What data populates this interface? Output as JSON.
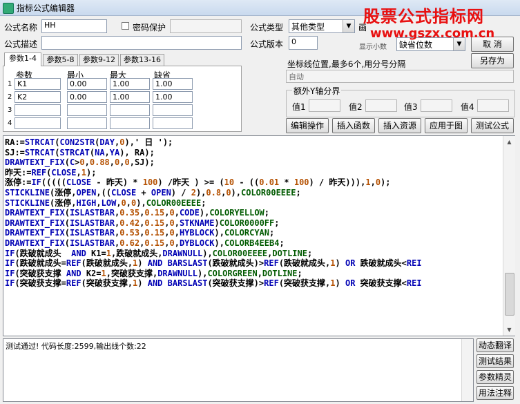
{
  "window": {
    "title": "指标公式编辑器"
  },
  "watermark": {
    "line1": "股票公式指标网",
    "line2": "www.gszx.com.cn",
    "color": "#e81010"
  },
  "form": {
    "name_label": "公式名称",
    "name_value": "HH",
    "password_label": "密码保护",
    "password_checked": false,
    "type_label": "公式类型",
    "type_value": "其他类型",
    "draw_label": "画",
    "desc_label": "公式描述",
    "desc_value": "",
    "version_label": "公式版本",
    "version_value": "0",
    "display_label": "显示小数",
    "display_value": "缺省位数"
  },
  "right_buttons": {
    "cancel": "取 消",
    "save_as": "另存为"
  },
  "tabs": [
    {
      "label": "参数1-4",
      "active": true
    },
    {
      "label": "参数5-8",
      "active": false
    },
    {
      "label": "参数9-12",
      "active": false
    },
    {
      "label": "参数13-16",
      "active": false
    }
  ],
  "params": {
    "headers": {
      "name": "参数",
      "min": "最小",
      "max": "最大",
      "default": "缺省"
    },
    "rows": [
      {
        "num": "1",
        "name": "K1",
        "min": "0.00",
        "max": "1.00",
        "default": "1.00"
      },
      {
        "num": "2",
        "name": "K2",
        "min": "0.00",
        "max": "1.00",
        "default": "1.00"
      },
      {
        "num": "3",
        "name": "",
        "min": "",
        "max": "",
        "default": ""
      },
      {
        "num": "4",
        "name": "",
        "min": "",
        "max": "",
        "default": ""
      }
    ]
  },
  "axis": {
    "label": "坐标线位置,最多6个,用分号分隔",
    "value": "自动",
    "extra_group_title": "额外Y轴分界",
    "values": [
      {
        "label": "值1",
        "value": ""
      },
      {
        "label": "值2",
        "value": ""
      },
      {
        "label": "值3",
        "value": ""
      },
      {
        "label": "值4",
        "value": ""
      }
    ]
  },
  "actions": {
    "edit_ops": "编辑操作",
    "insert_func": "插入函数",
    "insert_res": "插入资源",
    "apply_chart": "应用于图",
    "test": "测试公式"
  },
  "code_lines": [
    "RA:=STRCAT(CON2STR(DAY,0),' 日 ');",
    "SJ:=STRCAT(STRCAT(NA,YA), RA);",
    "DRAWTEXT_FIX(C>0,0.88,0,0,SJ);",
    "昨天:=REF(CLOSE,1);",
    "涨停:=IF(((((CLOSE - 昨天) * 100) /昨天 ) >= (10 - ((0.01 * 100) / 昨天))),1,0);",
    "STICKLINE(涨停,OPEN,((CLOSE + OPEN) / 2),0.8,0),COLOR00EEEE;",
    "STICKLINE(涨停,HIGH,LOW,0,0),COLOR00EEEE;",
    "DRAWTEXT_FIX(ISLASTBAR,0.35,0.15,0,CODE),COLORYELLOW;",
    "DRAWTEXT_FIX(ISLASTBAR,0.42,0.15,0,STKNAME)COLOR0000FF;",
    "DRAWTEXT_FIX(ISLASTBAR,0.53,0.15,0,HYBLOCK),COLORCYAN;",
    "DRAWTEXT_FIX(ISLASTBAR,0.62,0.15,0,DYBLOCK),COLORB4EEB4;",
    "IF(跌破就成头  AND K1=1,跌破就成头,DRAWNULL),COLOR00EEEE,DOTLINE;",
    "IF(跌破就成头=REF(跌破就成头,1) AND BARSLAST(跌破就成头)>REF(跌破就成头,1) OR 跌破就成头<REI",
    "IF(突破获支撑 AND K2=1,突破获支撑,DRAWNULL),COLORGREEN,DOTLINE;",
    "IF(突破获支撑=REF(突破获支撑,1) AND BARSLAST(突破获支撑)>REF(突破获支撑,1) OR 突破获支撑<REI"
  ],
  "message": "测试通过! 代码长度:2599,输出线个数:22",
  "side_buttons": {
    "dynamic": "动态翻译",
    "result": "测试结果",
    "param": "参数精灵",
    "usage": "用法注释"
  }
}
